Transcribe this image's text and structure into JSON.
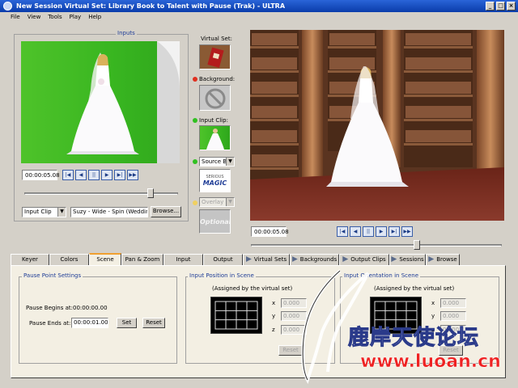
{
  "window": {
    "title": "New Session   Virtual Set: Library Book to Talent with Pause (Trak)  - ULTRA"
  },
  "menu": [
    "File",
    "View",
    "Tools",
    "Play",
    "Help"
  ],
  "inputs": {
    "label": "Inputs",
    "timecode": "00:00:05.08",
    "slider_position": 0.82,
    "source_select": "Input Clip",
    "clip_name": "Suzy - Wide - Spin (Wedding).",
    "browse_label": "Browse..."
  },
  "sidebar": {
    "virtual_set_label": "Virtual Set:",
    "background_label": "Background:",
    "input_clip_label": "Input Clip:",
    "source_select": "Source B",
    "logo_line1": "SERIOUS",
    "logo_line2": "MAGIC",
    "overlay_select": "Overlay 1",
    "optional_label": "Optional"
  },
  "output": {
    "timecode": "00:00:05.08",
    "slider_position": 0.66
  },
  "tabs": [
    {
      "label": "Keyer",
      "icon": false
    },
    {
      "label": "Colors",
      "icon": false
    },
    {
      "label": "Scene",
      "icon": false,
      "active": true
    },
    {
      "label": "Pan & Zoom",
      "icon": false
    },
    {
      "label": "Input",
      "icon": false
    },
    {
      "label": "Output",
      "icon": false
    },
    {
      "label": "Virtual Sets",
      "icon": true
    },
    {
      "label": "Backgrounds",
      "icon": true
    },
    {
      "label": "Output Clips",
      "icon": true
    },
    {
      "label": "Sessions",
      "icon": true
    },
    {
      "label": "Browse",
      "icon": true
    }
  ],
  "pause": {
    "title": "Pause Point Settings",
    "begins_label": "Pause Begins at:",
    "begins_value": "00:00:00.00",
    "ends_label": "Pause Ends at:",
    "ends_value": "00:00:01.00",
    "set_label": "Set",
    "reset_label": "Reset"
  },
  "position": {
    "title": "Input Position in Scene",
    "note": "(Assigned by the virtual set)",
    "x_label": "x",
    "x_value": "0.000",
    "y_label": "y",
    "y_value": "0.000",
    "z_label": "z",
    "z_value": "0.000",
    "reset_label": "Reset"
  },
  "orientation": {
    "title": "Input Orientation in Scene",
    "note": "(Assigned by the virtual set)",
    "x_label": "x",
    "x_value": "0.000",
    "y_label": "y",
    "y_value": "0.000",
    "z_label": "z",
    "z_value": "0.000",
    "reset_label": "Reset"
  },
  "watermark": {
    "line1": "鹿岸天使论坛",
    "line2": "www.luoan.cn"
  },
  "colors": {
    "title_bar": "#0a3caa",
    "green_screen": "#38b520",
    "library_wood": "#6b3f28",
    "active_tab_accent": "#f0a030",
    "group_title": "#1e3c96"
  }
}
